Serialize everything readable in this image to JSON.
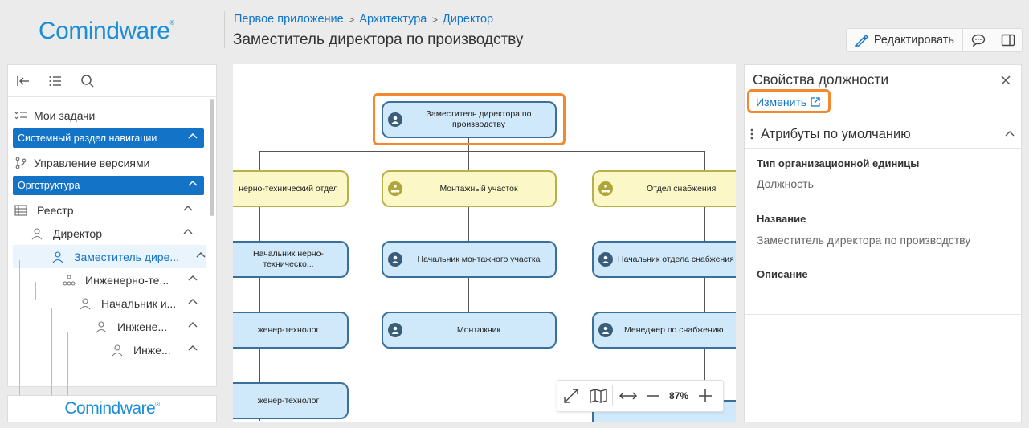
{
  "brand": {
    "name_a": "Com",
    "name_b": "ind",
    "name_c": "ware",
    "mark": "®"
  },
  "breadcrumbs": [
    "Первое приложение",
    "Архитектура",
    "Директор"
  ],
  "page_title": "Заместитель директора по производству",
  "header": {
    "edit_label": "Редактировать"
  },
  "nav": {
    "items": [
      {
        "label": "Мои задачи"
      },
      {
        "label": "Системный раздел навигации"
      },
      {
        "label": "Управление версиями"
      },
      {
        "label": "Оргструктура"
      },
      {
        "label": "Реестр"
      },
      {
        "label": "Директор"
      },
      {
        "label": "Заместитель дире..."
      },
      {
        "label": "Инженерно-те..."
      },
      {
        "label": "Начальник и..."
      },
      {
        "label": "Инжене..."
      },
      {
        "label": "Инже..."
      }
    ]
  },
  "org": {
    "root": "Заместитель директора по производству",
    "dept1": "нерно-технический отдел",
    "dept2": "Монтажный участок",
    "dept3": "Отдел снабжения",
    "head1": "Начальник нерно-техническо...",
    "head2": "Начальник монтажного участка",
    "head3": "Начальник отдела снабжения",
    "pos1": "женер-технолог",
    "pos2": "Монтажник",
    "pos3": "Менеджер по снабжению",
    "pos1b": "женер-технолог"
  },
  "zoom": {
    "level": "87%"
  },
  "props": {
    "title": "Свойства должности",
    "change_link": "Изменить",
    "section": "Атрибуты по умолчанию",
    "fields": [
      {
        "label": "Тип организационной единицы",
        "value": "Должность"
      },
      {
        "label": "Название",
        "value": "Заместитель директора по производству"
      },
      {
        "label": "Описание",
        "value": "–"
      }
    ]
  }
}
